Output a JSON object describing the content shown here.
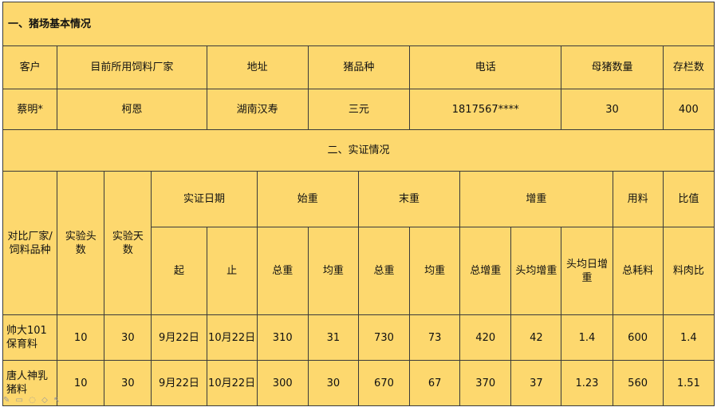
{
  "section1_title": "一、猪场基本情况",
  "basic": {
    "headers": {
      "customer": "客户",
      "feed_maker": "目前所用饲料厂家",
      "address": "地址",
      "breed": "猪品种",
      "phone": "电话",
      "sows": "母猪数量",
      "stock": "存栏数"
    },
    "values": {
      "customer": "蔡明*",
      "feed_maker": "柯恩",
      "address": "湖南汉寿",
      "breed": "三元",
      "phone": "1817567****",
      "sows": "30",
      "stock": "400"
    }
  },
  "section2_title": "二、实证情况",
  "trial": {
    "headers": {
      "compare": "对比厂家/饲料品种",
      "heads": "实验头数",
      "days": "实验天数",
      "date": "实证日期",
      "start_weight": "始重",
      "end_weight": "末重",
      "gain": "增重",
      "feed": "用料",
      "ratio": "比值",
      "from": "起",
      "to": "止",
      "total1": "总重",
      "avg1": "均重",
      "total2": "总重",
      "avg2": "均重",
      "total_gain": "总增重",
      "avg_gain_head": "头均增重",
      "avg_daily_gain": "头均日增重",
      "total_feed": "总耗料",
      "feed_meat_ratio": "料肉比"
    },
    "rows": [
      {
        "name": "帅大101保育料",
        "heads": "10",
        "days": "30",
        "from": "9月22日",
        "to": "10月22日",
        "start_total": "310",
        "start_avg": "31",
        "end_total": "730",
        "end_avg": "73",
        "total_gain": "420",
        "avg_gain_head": "42",
        "avg_daily_gain": "1.4",
        "total_feed": "600",
        "ratio": "1.4"
      },
      {
        "name": "唐人神乳猪料",
        "heads": "10",
        "days": "30",
        "from": "9月22日",
        "to": "10月22日",
        "start_total": "300",
        "start_avg": "30",
        "end_total": "670",
        "end_avg": "67",
        "total_gain": "370",
        "avg_gain_head": "37",
        "avg_daily_gain": "1.23",
        "total_feed": "560",
        "ratio": "1.51"
      }
    ]
  }
}
